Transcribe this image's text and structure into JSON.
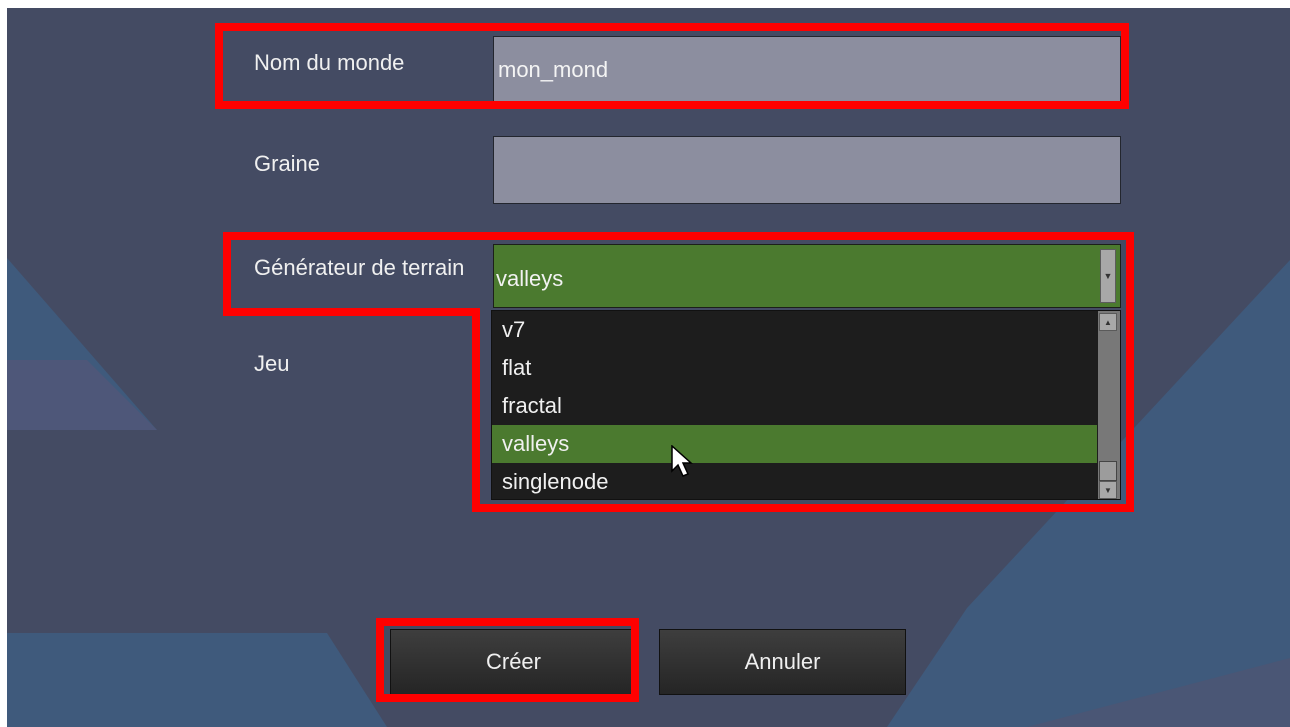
{
  "dialog": {
    "world_name": {
      "label": "Nom du monde",
      "value": "mon_mond"
    },
    "seed": {
      "label": "Graine",
      "value": ""
    },
    "mapgen": {
      "label": "Générateur de terrain",
      "value": "valleys",
      "options": [
        "v7",
        "flat",
        "fractal",
        "valleys",
        "singlenode"
      ],
      "selected_index": 3
    },
    "game": {
      "label": "Jeu"
    },
    "buttons": {
      "create": "Créer",
      "cancel": "Annuler"
    }
  },
  "colors": {
    "background": "#444b63",
    "field": "#8c8e9f",
    "selected": "#4b7a2f",
    "highlight": "#ff0000"
  }
}
